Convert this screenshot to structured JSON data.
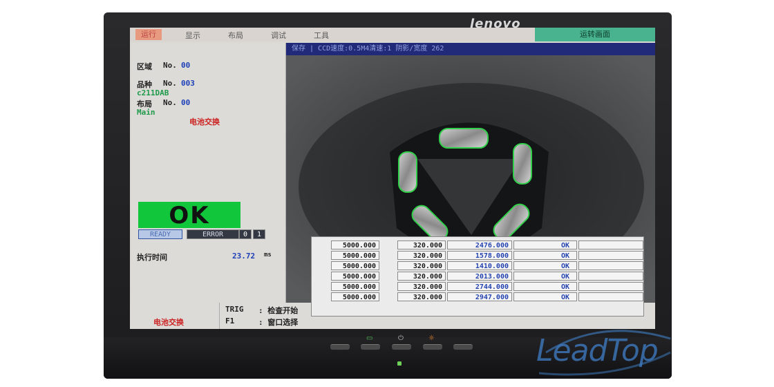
{
  "monitor": {
    "brand": "lenovo"
  },
  "menubar": {
    "items": [
      "运行",
      "显示",
      "布局",
      "调试",
      "工具"
    ],
    "right": "运转画面"
  },
  "camera": {
    "header": "保存  | CCD速度:0.5M4清速:1 阴影/宽度 262"
  },
  "left_panel": {
    "area_label": "区域",
    "area_no_label": "No.",
    "area_no": "00",
    "product_label": "品种",
    "product_no_label": "No.",
    "product_no": "003",
    "product_name": "c211DAB",
    "layout_label": "布局",
    "layout_no_label": "No.",
    "layout_no": "00",
    "layout_name": "Main",
    "battery_warning": "电池交换",
    "ok_text": "OK",
    "ready": "READY",
    "error": "ERROR",
    "digit1": "0",
    "digit2": "1",
    "exec_time_label": "执行时间",
    "exec_time_value": "23.72",
    "exec_time_unit": "ms"
  },
  "bottom_strip": {
    "battery_warning": "电池交换",
    "trig_key": "TRIG",
    "trig_desc": ": 检查开始",
    "f1_key": "F1",
    "f1_desc": ": 窗口选择"
  },
  "table": {
    "rows": [
      [
        "5000.000",
        "320.000",
        "2476.000",
        "OK"
      ],
      [
        "5000.000",
        "320.000",
        "1578.000",
        "OK"
      ],
      [
        "5000.000",
        "320.000",
        "1410.000",
        "OK"
      ],
      [
        "5000.000",
        "320.000",
        "2013.000",
        "OK"
      ],
      [
        "5000.000",
        "320.000",
        "2744.000",
        "OK"
      ],
      [
        "5000.000",
        "320.000",
        "2947.000",
        "OK"
      ]
    ]
  },
  "watermark": "LeadTop",
  "colors": {
    "ok_green": "#12c63b",
    "header_blue": "#202a78",
    "menu_right": "#49b28f",
    "value_blue": "#1c3fb8",
    "warning_red": "#cc2222"
  }
}
